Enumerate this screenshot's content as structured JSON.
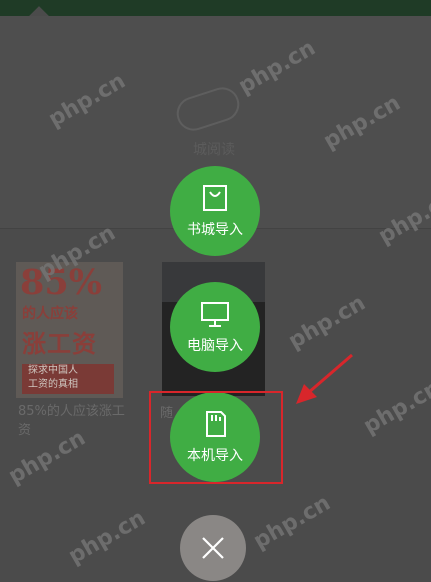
{
  "background": {
    "hint_text": "城阅读",
    "books": [
      {
        "cover_lines": [
          "85%",
          "的人应该",
          "涨工资",
          "探求中国人",
          "工资的真相"
        ],
        "title": "85%的人应该涨工资"
      },
      {
        "title": "随"
      }
    ]
  },
  "import_menu": {
    "bookstore": {
      "label": "书城导入",
      "icon": "shopping-bag-icon"
    },
    "computer": {
      "label": "电脑导入",
      "icon": "monitor-icon"
    },
    "local": {
      "label": "本机导入",
      "icon": "sd-card-icon"
    }
  },
  "close": {
    "icon": "close-icon"
  },
  "watermark": "php.cn",
  "colors": {
    "accent": "#40ad44",
    "highlight": "#d8262b",
    "overlay": "#4b4b4b"
  }
}
